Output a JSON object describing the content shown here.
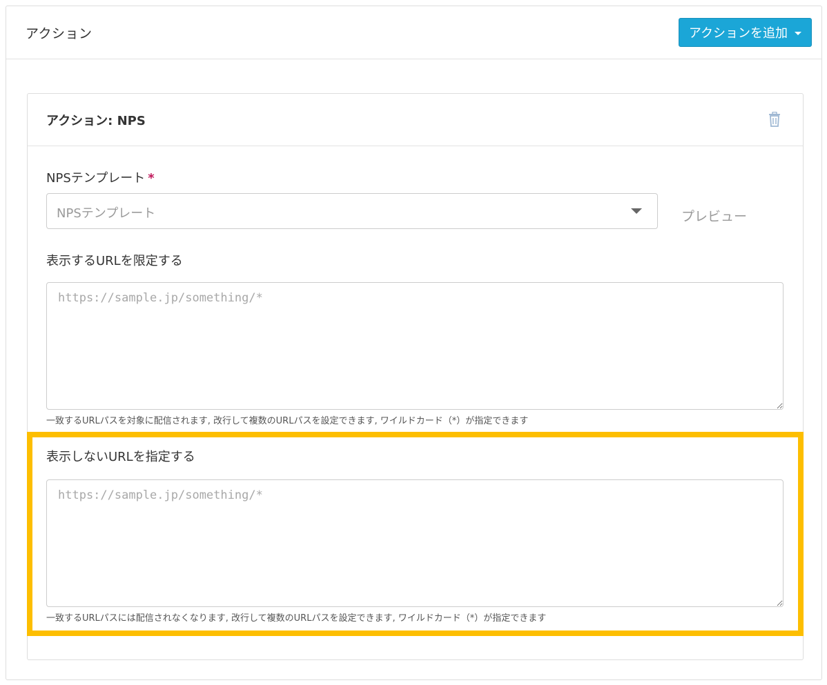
{
  "outer_panel": {
    "title": "アクション",
    "add_action_button_label": "アクションを追加"
  },
  "action_card": {
    "title": "アクション: NPS",
    "nps_template": {
      "label": "NPSテンプレート",
      "required_mark": "*",
      "placeholder": "NPSテンプレート",
      "preview_label": "プレビュー"
    },
    "include_urls": {
      "label": "表示するURLを限定する",
      "placeholder": "https://sample.jp/something/*",
      "value": "",
      "help": "一致するURLパスを対象に配信されます, 改行して複数のURLパスを設定できます, ワイルドカード（*）が指定できます"
    },
    "exclude_urls": {
      "label": "表示しないURLを指定する",
      "placeholder": "https://sample.jp/something/*",
      "value": "",
      "help": "一致するURLパスには配信されなくなります, 改行して複数のURLパスを設定できます, ワイルドカード（*）が指定できます"
    }
  },
  "colors": {
    "primary_button": "#1ba6d7",
    "highlight": "#fdbe00",
    "required_mark": "#c0185b"
  },
  "icons": {
    "delete": "trash-icon",
    "dropdown": "caret-down-icon"
  }
}
